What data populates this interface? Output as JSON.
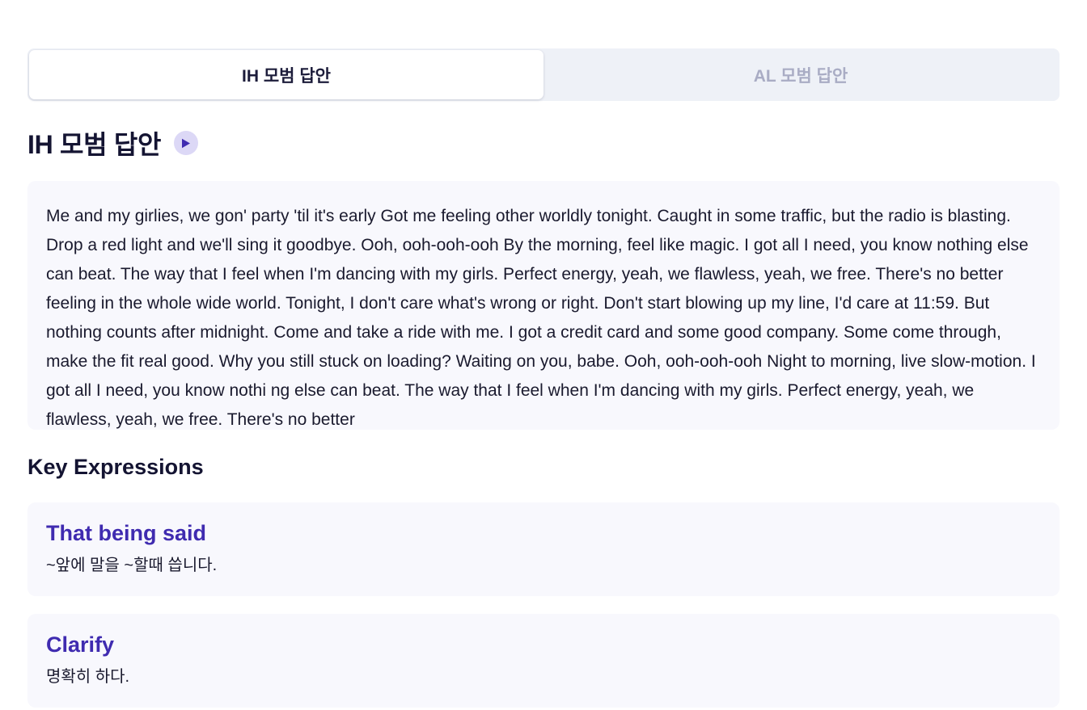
{
  "tabs": [
    {
      "label": "IH 모범 답안",
      "active": true
    },
    {
      "label": "AL 모범 답안",
      "active": false
    }
  ],
  "answer": {
    "title": "IH 모범 답안",
    "play_icon": "play-icon",
    "text": "Me and my girlies, we gon' party 'til it's early Got me feeling other worldly tonight. Caught in some traffic, but the radio is blasting. Drop a red light and we'll sing it goodbye. Ooh, ooh-ooh-ooh By the morning, feel like magic. I got all I need, you know nothing else can beat. The way that I feel when I'm dancing with my girls. Perfect energy, yeah, we flawless, yeah, we free. There's no better feeling in the whole wide world. Tonight, I don't care what's wrong or right. Don't start blowing up my line, I'd care at 11:59. But nothing counts after midnight. Come and take a ride with me. I got a credit card and some good company. Some come through, make the fit real good. Why you still stuck on loading? Waiting on you, babe. Ooh, ooh-ooh-ooh Night to morning, live slow-motion. I got all I need, you know nothi ng else can beat. The way that I feel when I'm dancing with my girls. Perfect energy, yeah, we flawless, yeah, we free. There's no better"
  },
  "key_expressions": {
    "title": "Key Expressions",
    "items": [
      {
        "term": "That being said",
        "meaning": "~앞에 말을 ~할때 씁니다."
      },
      {
        "term": "Clarify",
        "meaning": "명확히 하다."
      }
    ]
  },
  "colors": {
    "accent": "#3f2bb0",
    "play_button_bg": "#dcd8f6",
    "card_bg": "#f8f8fd",
    "tab_bar_bg": "#eef1f7",
    "inactive_tab_text": "#a9acc4"
  }
}
